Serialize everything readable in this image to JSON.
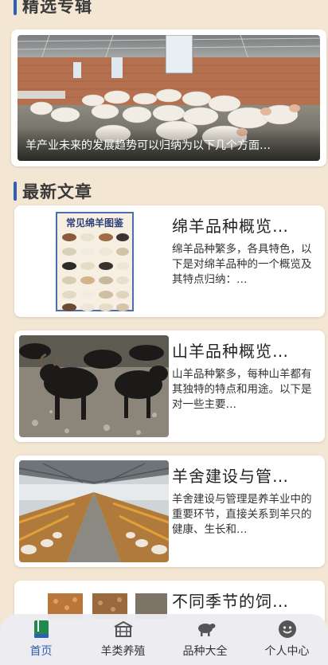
{
  "featured": {
    "section_title": "精选专辑",
    "caption": "羊产业未来的发展趋势可以归纳为以下几个方面…"
  },
  "latest": {
    "section_title": "最新文章",
    "articles": [
      {
        "title": "绵羊品种概览…",
        "summary": "绵羊品种繁多，各具特色，以下是对绵羊品种的一个概览及其特点归纳：…",
        "thumb_title": "常见绵羊图鉴"
      },
      {
        "title": "山羊品种概览…",
        "summary": "山羊品种繁多，每种山羊都有其独特的特点和用途。以下是对一些主要…"
      },
      {
        "title": "羊舍建设与管…",
        "summary": "羊舍建设与管理是养羊业中的重要环节，直接关系到羊只的健康、生长和…"
      },
      {
        "title": "不同季节的饲…",
        "summary": ""
      }
    ]
  },
  "tabbar": {
    "items": [
      {
        "label": "首页",
        "icon": "home-book-icon",
        "active": true
      },
      {
        "label": "羊类养殖",
        "icon": "barn-icon",
        "active": false
      },
      {
        "label": "品种大全",
        "icon": "sheep-icon",
        "active": false
      },
      {
        "label": "个人中心",
        "icon": "smiley-user-icon",
        "active": false
      }
    ]
  },
  "colors": {
    "background": "#f3e6d3",
    "accent": "#2f5fb0",
    "card": "#ffffff"
  }
}
